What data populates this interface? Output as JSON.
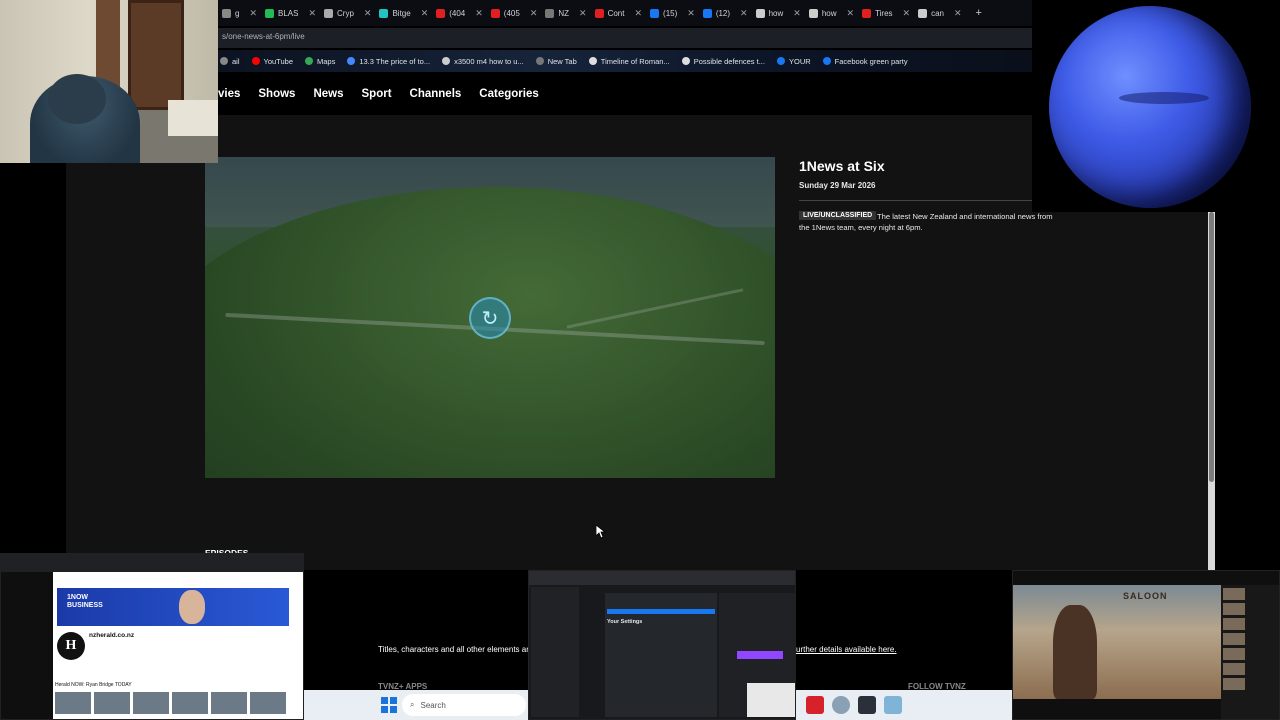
{
  "browser": {
    "tabs": [
      {
        "label": "g",
        "color": "#888888"
      },
      {
        "label": "BLAS",
        "color": "#22bb55"
      },
      {
        "label": "Cryp",
        "color": "#aaaaaa"
      },
      {
        "label": "Bitge",
        "color": "#22c3c3"
      },
      {
        "label": "(404",
        "color": "#e02020"
      },
      {
        "label": "(405",
        "color": "#e02020"
      },
      {
        "label": "NZ",
        "color": "#777777"
      },
      {
        "label": "Cont",
        "color": "#e02020"
      },
      {
        "label": "(15)",
        "color": "#1877f2"
      },
      {
        "label": "(12)",
        "color": "#1877f2"
      },
      {
        "label": "how",
        "color": "#cccccc"
      },
      {
        "label": "how",
        "color": "#cccccc"
      },
      {
        "label": "Tires",
        "color": "#e02020"
      },
      {
        "label": "can",
        "color": "#cccccc"
      }
    ],
    "new_tab_symbol": "+",
    "url": "s/one-news-at-6pm/live",
    "bookmarks": [
      {
        "label": "ail",
        "color": "#888888"
      },
      {
        "label": "YouTube",
        "color": "#ff0000"
      },
      {
        "label": "Maps",
        "color": "#34a853"
      },
      {
        "label": "13.3 The price of to...",
        "color": "#4488ff"
      },
      {
        "label": "x3500 m4 how to u...",
        "color": "#cccccc"
      },
      {
        "label": "New Tab",
        "color": "#777777"
      },
      {
        "label": "Timeline of Roman...",
        "color": "#dddddd"
      },
      {
        "label": "Possible defences t...",
        "color": "#dddddd"
      },
      {
        "label": "YOUR",
        "color": "#1877f2"
      },
      {
        "label": "Facebook green party",
        "color": "#1877f2"
      }
    ]
  },
  "site_nav": [
    "vies",
    "Shows",
    "News",
    "Sport",
    "Channels",
    "Categories"
  ],
  "show": {
    "title": "1News at Six",
    "date": "Sunday 29 Mar 2026",
    "badge": "LIVE/UNCLASSIFIED",
    "description": "The latest New Zealand and international news from the 1News team, every night at 6pm."
  },
  "player": {
    "spinner_symbol": "↻",
    "state": "loading"
  },
  "episodes_heading": "EPISODES",
  "footer": {
    "legal_text": "Titles, characters and all other elements are",
    "legal_link": "urther details available here.",
    "apps_label": "TVNZ+ APPS",
    "follow_label": "FOLLOW TVNZ"
  },
  "taskbar": {
    "search_placeholder": "Search"
  },
  "thumbnails": {
    "youtube": {
      "banner_line1": "1NOW",
      "banner_line2": "BUSINESS",
      "channel_name": "nzherald.co.nz",
      "logo_letter": "H",
      "video_title": "Herald NOW: Ryan Bridge TODAY"
    },
    "facebook": {
      "panel_title": "Your Settings"
    },
    "video": {
      "sign_text": "SALOON"
    }
  },
  "colors": {
    "page_bg": "#000000",
    "content_bg": "#121212",
    "accent_blue": "#1877f2",
    "planet_blue": "#3f5ce8"
  }
}
